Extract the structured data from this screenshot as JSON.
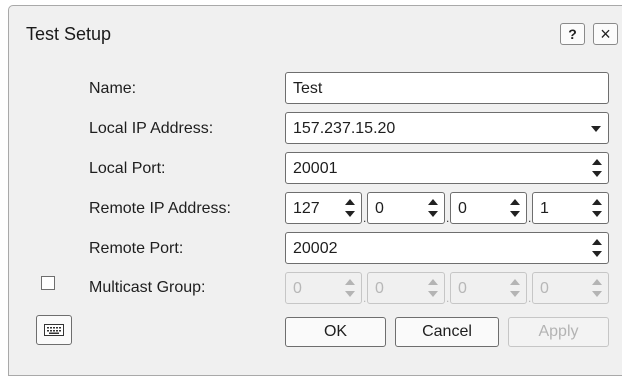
{
  "dialog": {
    "title": "Test Setup",
    "help_label": "?",
    "close_label": "×"
  },
  "form": {
    "name_label": "Name:",
    "name_value": "Test",
    "local_ip_label": "Local IP Address:",
    "local_ip_value": "157.237.15.20",
    "local_port_label": "Local Port:",
    "local_port_value": "20001",
    "remote_ip_label": "Remote IP Address:",
    "remote_ip_octets": [
      "127",
      "0",
      "0",
      "1"
    ],
    "remote_port_label": "Remote Port:",
    "remote_port_value": "20002",
    "multicast_label": "Multicast Group:",
    "multicast_checked": false,
    "multicast_octets": [
      "0",
      "0",
      "0",
      "0"
    ]
  },
  "buttons": {
    "ok": "OK",
    "cancel": "Cancel",
    "apply": "Apply",
    "keyboard_icon": "keyboard-icon"
  }
}
